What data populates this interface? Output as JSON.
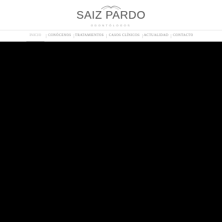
{
  "brand": {
    "name": "SAIZ PARDO",
    "tagline": "ODONTÓLOGOS"
  },
  "nav": {
    "items": [
      {
        "label": "INICIO",
        "active": true
      },
      {
        "label": "CONÓCENOS",
        "active": false
      },
      {
        "label": "TRATAMIENTOS",
        "active": false
      },
      {
        "label": "CASOS CLÍNICOS",
        "active": false
      },
      {
        "label": "ACTUALIDAD",
        "active": false
      },
      {
        "label": "CONTACTO",
        "active": false
      }
    ]
  },
  "colors": {
    "header_bg": "#ffffff",
    "stage_bg": "#000000",
    "brand_text": "#555555",
    "nav_text": "#8a8a8a"
  }
}
